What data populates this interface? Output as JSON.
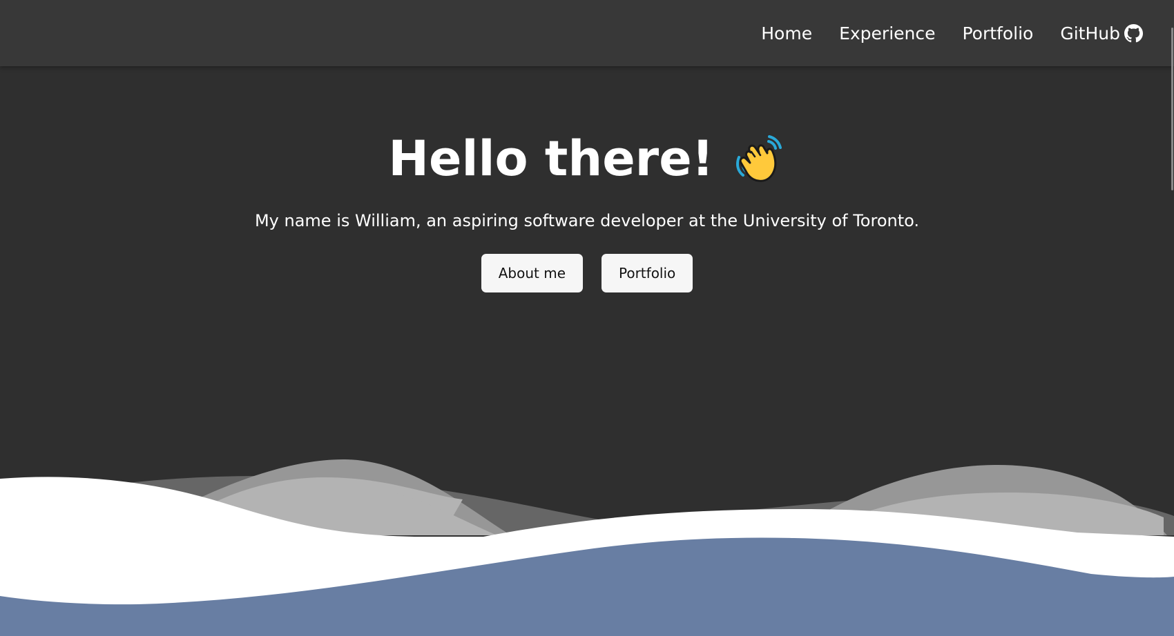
{
  "navbar": {
    "links": [
      {
        "label": "Home"
      },
      {
        "label": "Experience"
      },
      {
        "label": "Portfolio"
      },
      {
        "label": "GitHub",
        "icon": "github-icon"
      }
    ]
  },
  "hero": {
    "title": "Hello there!",
    "title_icon": "waving-hand-icon",
    "subtitle": "My name is William, an aspiring software developer at the University of Toronto.",
    "buttons": {
      "about": "About me",
      "portfolio": "Portfolio"
    }
  },
  "colors": {
    "background": "#2f2f2f",
    "navbar": "#383838",
    "wave_white": "#ffffff",
    "wave_blue": "#687ea3",
    "wave_gray_dark": "#666666",
    "wave_gray_mid": "#979797",
    "wave_gray_light": "#b3b3b3"
  }
}
